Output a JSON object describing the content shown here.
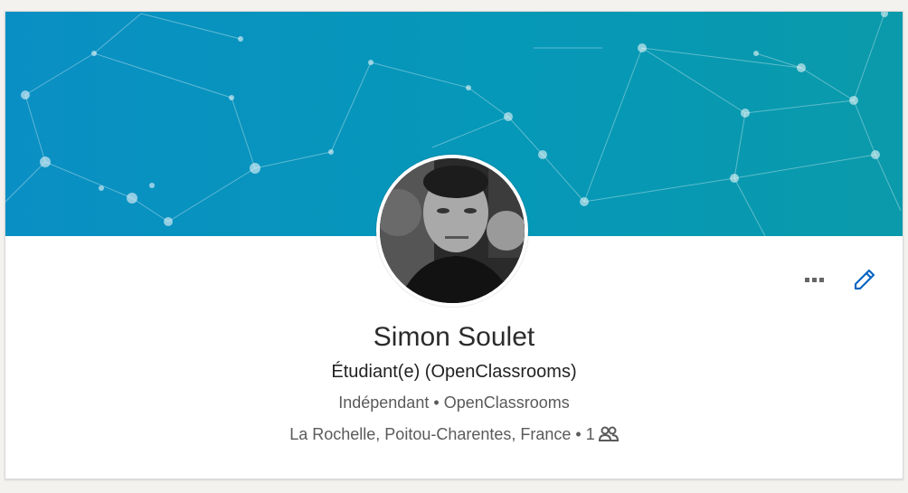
{
  "profile": {
    "name": "Simon Soulet",
    "headline": "Étudiant(e) (OpenClassrooms)",
    "company": "Indépendant",
    "school": "OpenClassrooms",
    "separator": "•",
    "location": "La Rochelle, Poitou-Charentes, France",
    "connections": "1"
  },
  "actions": {
    "more_icon": "ellipsis-icon",
    "edit_icon": "pencil-icon"
  },
  "colors": {
    "banner_start": "#0a8fc4",
    "banner_end": "#0a9aab",
    "accent": "#0a66c2"
  }
}
